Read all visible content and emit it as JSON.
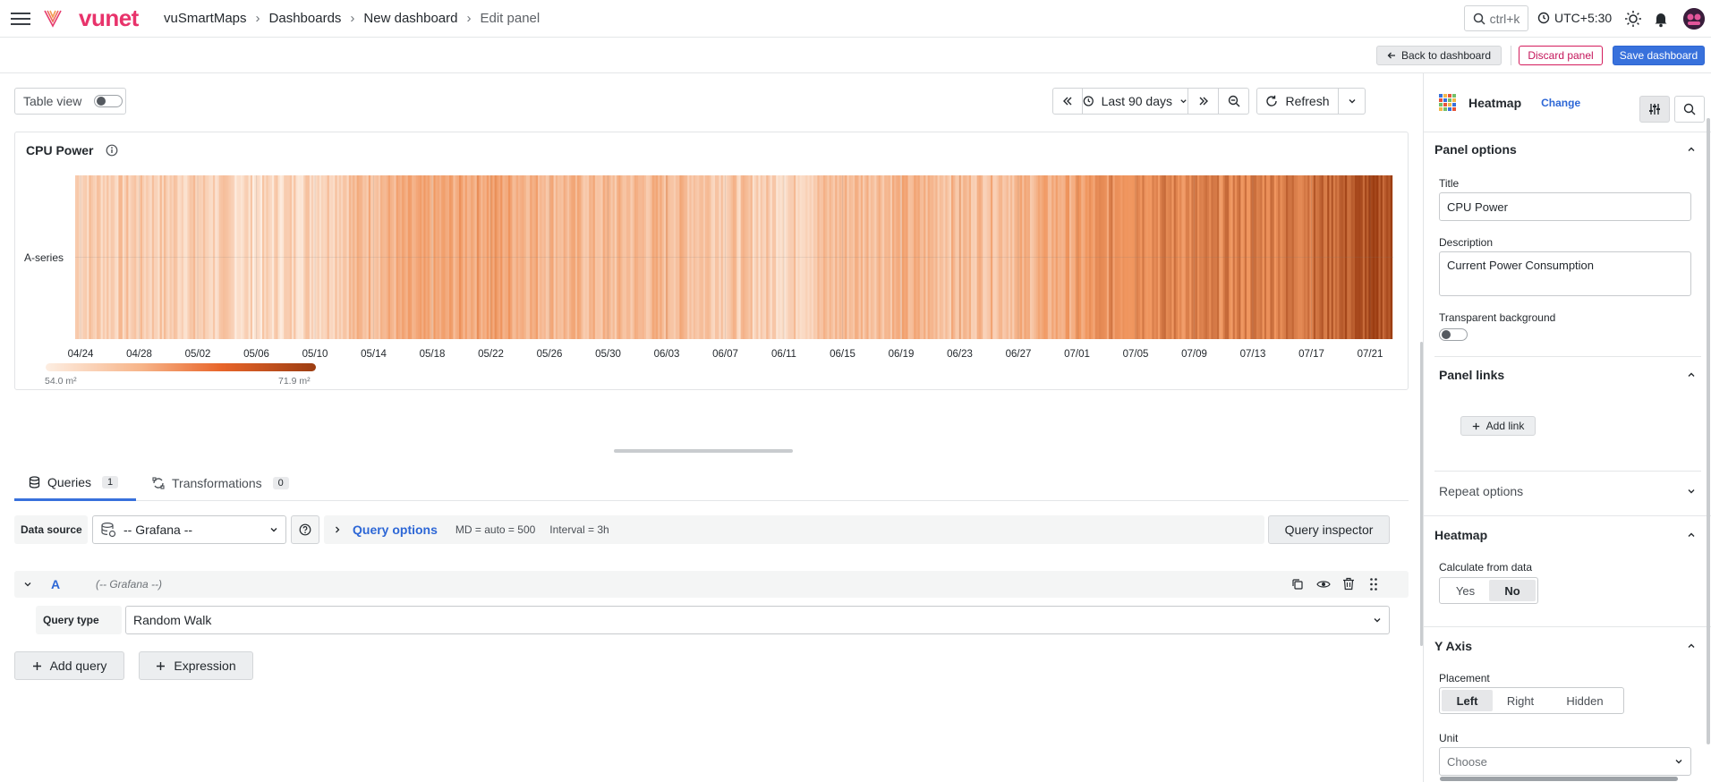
{
  "nav": {
    "brand": "vunet",
    "breadcrumbs": [
      "vuSmartMaps",
      "Dashboards",
      "New dashboard",
      "Edit panel"
    ],
    "search_label": "ctrl+k",
    "timezone": "UTC+5:30"
  },
  "toolbar": {
    "back_label": "Back to dashboard",
    "discard_label": "Discard panel",
    "save_label": "Save dashboard"
  },
  "viewbar": {
    "table_view_label": "Table view",
    "time_range": "Last 90 days",
    "refresh_label": "Refresh"
  },
  "panel": {
    "title": "CPU Power",
    "series_label": "A-series",
    "legend_min": "54.0 m²",
    "legend_max": "71.9 m²"
  },
  "chart_data": {
    "type": "heatmap",
    "title": "CPU Power",
    "series": [
      {
        "name": "A-series"
      }
    ],
    "x_ticks": [
      "04/24",
      "04/28",
      "05/02",
      "05/06",
      "05/10",
      "05/14",
      "05/18",
      "05/22",
      "05/26",
      "05/30",
      "06/03",
      "06/07",
      "06/11",
      "06/15",
      "06/19",
      "06/23",
      "06/27",
      "07/01",
      "07/05",
      "07/09",
      "07/13",
      "07/17",
      "07/21"
    ],
    "color_scale": {
      "min": 54.0,
      "max": 71.9,
      "unit": "m²",
      "low_color": "#fdeee2",
      "high_color": "#9c3d12"
    },
    "intensity_profile": [
      {
        "date": "04/24",
        "level": 0.22
      },
      {
        "date": "04/28",
        "level": 0.22
      },
      {
        "date": "05/02",
        "level": 0.2
      },
      {
        "date": "05/06",
        "level": 0.12
      },
      {
        "date": "05/10",
        "level": 0.2
      },
      {
        "date": "05/14",
        "level": 0.35
      },
      {
        "date": "05/18",
        "level": 0.4
      },
      {
        "date": "05/22",
        "level": 0.48
      },
      {
        "date": "05/26",
        "level": 0.36
      },
      {
        "date": "05/30",
        "level": 0.3
      },
      {
        "date": "06/03",
        "level": 0.34
      },
      {
        "date": "06/07",
        "level": 0.26
      },
      {
        "date": "06/11",
        "level": 0.18
      },
      {
        "date": "06/15",
        "level": 0.32
      },
      {
        "date": "06/19",
        "level": 0.36
      },
      {
        "date": "06/23",
        "level": 0.3
      },
      {
        "date": "06/27",
        "level": 0.34
      },
      {
        "date": "07/01",
        "level": 0.46
      },
      {
        "date": "07/05",
        "level": 0.66
      },
      {
        "date": "07/09",
        "level": 0.62
      },
      {
        "date": "07/13",
        "level": 0.66
      },
      {
        "date": "07/17",
        "level": 0.74
      },
      {
        "date": "07/21",
        "level": 0.9
      }
    ]
  },
  "query_tabs": [
    {
      "label": "Queries",
      "count": "1"
    },
    {
      "label": "Transformations",
      "count": "0"
    }
  ],
  "query_bar": {
    "data_source_label": "Data source",
    "data_source_value": "-- Grafana --",
    "query_options_label": "Query options",
    "md_text": "MD = auto = 500",
    "interval_text": "Interval = 3h",
    "inspector_label": "Query inspector"
  },
  "query": {
    "ref_id": "A",
    "source_hint": "(-- Grafana --)",
    "type_label": "Query type",
    "type_value": "Random Walk",
    "add_query_label": "Add query",
    "expression_label": "Expression"
  },
  "options": {
    "viz_name": "Heatmap",
    "change_label": "Change",
    "panel_options_title": "Panel options",
    "title_label": "Title",
    "title_value": "CPU Power",
    "description_label": "Description",
    "description_value": "Current Power Consumption",
    "transparent_label": "Transparent background",
    "panel_links_title": "Panel links",
    "add_link_label": "Add link",
    "repeat_title": "Repeat options",
    "heatmap_title": "Heatmap",
    "calc_label": "Calculate from data",
    "calc_options": [
      "Yes",
      "No"
    ],
    "calc_selected": "No",
    "yaxis_title": "Y Axis",
    "placement_label": "Placement",
    "placement_options": [
      "Left",
      "Right",
      "Hidden"
    ],
    "placement_selected": "Left",
    "unit_label": "Unit",
    "unit_placeholder": "Choose"
  },
  "colors": {
    "accent": "#3871dc",
    "danger": "#d41c5c",
    "heat_low": "#fdeee2",
    "heat_high": "#9c3d12"
  }
}
